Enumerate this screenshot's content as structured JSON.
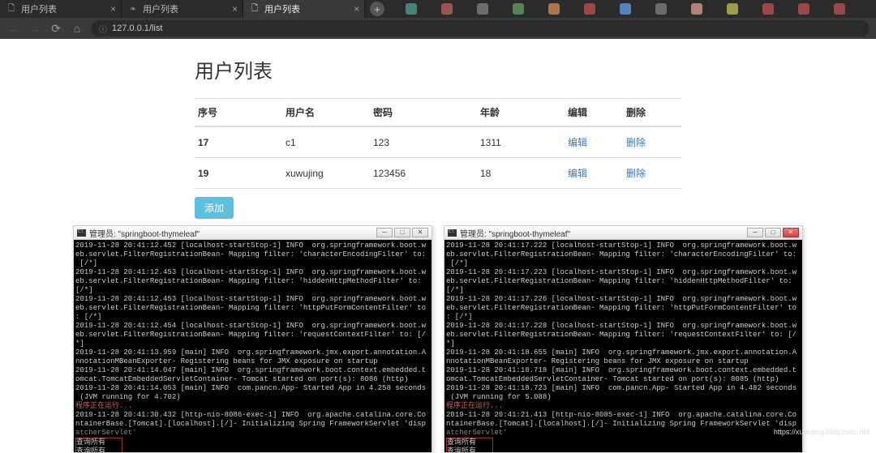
{
  "browser": {
    "tabs": [
      {
        "label": "用户列表",
        "icon_color": "#888"
      },
      {
        "label": "用户列表",
        "icon_color": "#6a4"
      },
      {
        "label": "用户列表",
        "icon_color": "#888",
        "active": true
      }
    ],
    "url": "127.0.0.1/list",
    "bookmark_colors": [
      "#5a9",
      "#c66",
      "#888",
      "#6a6",
      "#d95",
      "#c55",
      "#6af",
      "#888",
      "#ea9",
      "#cc5",
      "#c55",
      "#c55",
      "#c55"
    ]
  },
  "page": {
    "title": "用户列表",
    "columns": [
      "序号",
      "用户名",
      "密码",
      "年龄",
      "编辑",
      "删除"
    ],
    "rows": [
      {
        "id": "17",
        "username": "c1",
        "password": "123",
        "age": "1311",
        "edit": "编辑",
        "delete": "删除"
      },
      {
        "id": "19",
        "username": "xuwujing",
        "password": "123456",
        "age": "18",
        "edit": "编辑",
        "delete": "删除"
      }
    ],
    "add_button": "添加"
  },
  "terminals": [
    {
      "title": "管理员: \"springboot-thymeleaf\"",
      "lines": [
        "2019-11-28 20:41:12.452 [localhost-startStop-1] INFO  org.springframework.boot.w",
        "eb.servlet.FilterRegistrationBean- Mapping filter: 'characterEncodingFilter' to:",
        " [/*]",
        "2019-11-28 20:41:12.453 [localhost-startStop-1] INFO  org.springframework.boot.w",
        "eb.servlet.FilterRegistrationBean- Mapping filter: 'hiddenHttpMethodFilter' to: ",
        "[/*]",
        "2019-11-28 20:41:12.453 [localhost-startStop-1] INFO  org.springframework.boot.w",
        "eb.servlet.FilterRegistrationBean- Mapping filter: 'httpPutFormContentFilter' to",
        ": [/*]",
        "2019-11-28 20:41:12.454 [localhost-startStop-1] INFO  org.springframework.boot.w",
        "eb.servlet.FilterRegistrationBean- Mapping filter: 'requestContextFilter' to: [/",
        "*]",
        "2019-11-28 20:41:13.959 [main] INFO  org.springframework.jmx.export.annotation.A",
        "nnotationMBeanExporter- Registering beans for JMX exposure on startup",
        "2019-11-28 20:41:14.047 [main] INFO  org.springframework.boot.context.embedded.t",
        "omcat.TomcatEmbeddedServletContainer- Tomcat started on port(s): 8086 (http)",
        "2019-11-28 20:41:14.053 [main] INFO  com.pancn.App- Started App in 4.258 seconds",
        " (JVM running for 4.702)"
      ],
      "running": "程序正在运行...",
      "tail": [
        "2019-11-28 20:41:30.432 [http-nio-8086-exec-1] INFO  org.apache.catalina.core.Co",
        "ntainerBase.[Tomcat].[localhost].[/]- Initializing Spring FrameworkServlet 'disp"
      ],
      "tail_faded": "atcherServlet'",
      "box_lines": [
        "查询所有",
        "查询所有"
      ]
    },
    {
      "title": "管理员: \"springboot-thymeleaf\"",
      "lines": [
        "2019-11-28 20:41:17.222 [localhost-startStop-1] INFO  org.springframework.boot.w",
        "eb.servlet.FilterRegistrationBean- Mapping filter: 'characterEncodingFilter' to:",
        " [/*]",
        "2019-11-28 20:41:17.223 [localhost-startStop-1] INFO  org.springframework.boot.w",
        "eb.servlet.FilterRegistrationBean- Mapping filter: 'hiddenHttpMethodFilter' to: ",
        "[/*]",
        "2019-11-28 20:41:17.226 [localhost-startStop-1] INFO  org.springframework.boot.w",
        "eb.servlet.FilterRegistrationBean- Mapping filter: 'httpPutFormContentFilter' to",
        ": [/*]",
        "2019-11-28 20:41:17.228 [localhost-startStop-1] INFO  org.springframework.boot.w",
        "eb.servlet.FilterRegistrationBean- Mapping filter: 'requestContextFilter' to: [/",
        "*]",
        "2019-11-28 20:41:18.655 [main] INFO  org.springframework.jmx.export.annotation.A",
        "nnotationMBeanExporter- Registering beans for JMX exposure on startup",
        "2019-11-28 20:41:18.718 [main] INFO  org.springframework.boot.context.embedded.t",
        "omcat.TomcatEmbeddedServletContainer- Tomcat started on port(s): 8085 (http)",
        "2019-11-28 20:41:18.723 [main] INFO  com.pancn.App- Started App in 4.482 seconds",
        " (JVM running for 5.088)"
      ],
      "running": "程序正在运行...",
      "tail": [
        "2019-11-28 20:41:21.413 [http-nio-8085-exec-1] INFO  org.apache.catalina.core.Co",
        "ntainerBase.[Tomcat].[localhost].[/]- Initializing Spring FrameworkServlet 'disp"
      ],
      "tail_faded": "atcherServlet'",
      "box_lines": [
        "查询所有",
        "查询所有"
      ]
    }
  ],
  "watermark": "https://xuwujing.blog.csdn.net"
}
